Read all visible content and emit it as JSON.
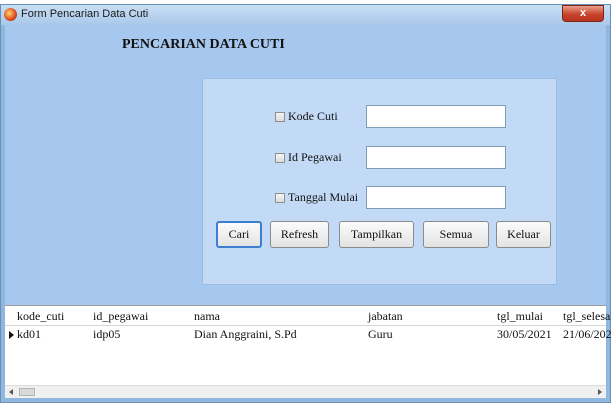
{
  "window": {
    "title": "Form Pencarian Data Cuti",
    "close_label": "x"
  },
  "form": {
    "heading": "PENCARIAN DATA CUTI"
  },
  "filters": [
    {
      "label": "Kode Cuti",
      "checked": false,
      "value": ""
    },
    {
      "label": "Id Pegawai",
      "checked": false,
      "value": ""
    },
    {
      "label": "Tanggal Mulai",
      "checked": false,
      "value": ""
    }
  ],
  "buttons": {
    "cari": "Cari",
    "refresh": "Refresh",
    "tampilkan": "Tampilkan",
    "semua": "Semua",
    "keluar": "Keluar"
  },
  "grid": {
    "columns": [
      "kode_cuti",
      "id_pegawai",
      "nama",
      "jabatan",
      "tgl_mulai",
      "tgl_selesai"
    ],
    "rows": [
      [
        "kd01",
        "idp05",
        "Dian Anggraini, S.Pd",
        "Guru",
        "30/05/2021",
        "21/06/202"
      ]
    ]
  },
  "colors": {
    "client_bg": "#a7c8ee",
    "panel_bg": "#c3daf6",
    "close_red": "#c8432c"
  }
}
